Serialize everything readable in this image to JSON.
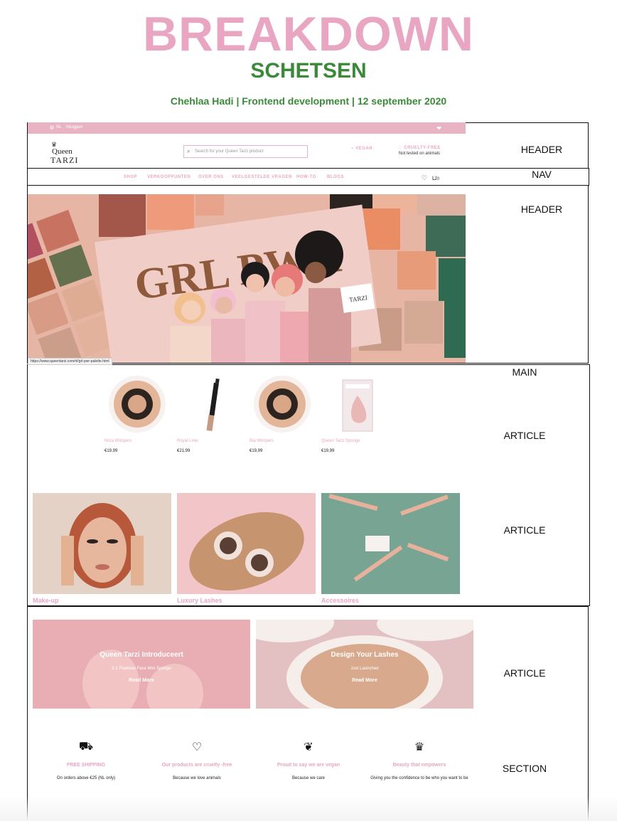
{
  "doc": {
    "title": "BREAKDOWN",
    "subtitle": "SCHETSEN",
    "author_line": "Chehlaa Hadi | Frontend development | 12 september 2020"
  },
  "labels": {
    "header1": "HEADER",
    "nav": "NAV",
    "header2": "HEADER",
    "main": "MAIN",
    "article1": "ARTICLE",
    "article2": "ARTICLE",
    "article3": "ARTICLE",
    "section": "SECTION"
  },
  "site": {
    "topbar": {
      "lang": "NL",
      "login": "Inloggen"
    },
    "logo": {
      "line1": "Queen",
      "line2": "TARZI"
    },
    "search": {
      "placeholder": "Search for your Queen Tarzi product"
    },
    "vegan": "VEGAN",
    "cruelty_title": "CRUELTY-FREE",
    "cruelty_sub": "Not tested on animals",
    "nav": [
      "SHOP",
      "VERKOOPPUNTEN",
      "OVER ONS",
      "VEELGESTELDE VRAGEN",
      "HOW-TO",
      "BLOGS"
    ],
    "cart_count": "0",
    "hero_text": "GRL PWR",
    "status_url": "https://www.queentarzi.com/nl/grl-pwr-palette.html",
    "products": [
      {
        "name": "Nora Wimpers",
        "price": "€19,99"
      },
      {
        "name": "Royal Liner",
        "price": "€21,99"
      },
      {
        "name": "Bia Wimpers",
        "price": "€19,99"
      },
      {
        "name": "Queen Tarzi Sponge",
        "price": "€19,99"
      }
    ],
    "categories": [
      "Make-up",
      "Luxury Lashes",
      "Accessoires"
    ],
    "banners": [
      {
        "title": "Queen Tarzi Introduceert",
        "sub": "3-1 Flawless Face Mini Sponge",
        "cta": "Read More"
      },
      {
        "title": "Design Your Lashes",
        "sub": "Just Launched",
        "cta": "Read More"
      }
    ],
    "usps": [
      {
        "icon": "truck-icon",
        "title": "FREE SHIPPING",
        "desc": "On orders above €25 (NL only)"
      },
      {
        "icon": "hearts-icon",
        "title": "Our products are cruelty -free",
        "desc": "Because we love animals"
      },
      {
        "icon": "leaf-icon",
        "title": "Proud to say we are vegan",
        "desc": "Because we care"
      },
      {
        "icon": "crown-icon",
        "title": "Beauty that empowers",
        "desc": "Giving you the confidence to be who you want to be"
      }
    ]
  },
  "colors": {
    "pink": "#e8a6c2",
    "green": "#3b8a3a",
    "bar": "#e8b3c2"
  }
}
